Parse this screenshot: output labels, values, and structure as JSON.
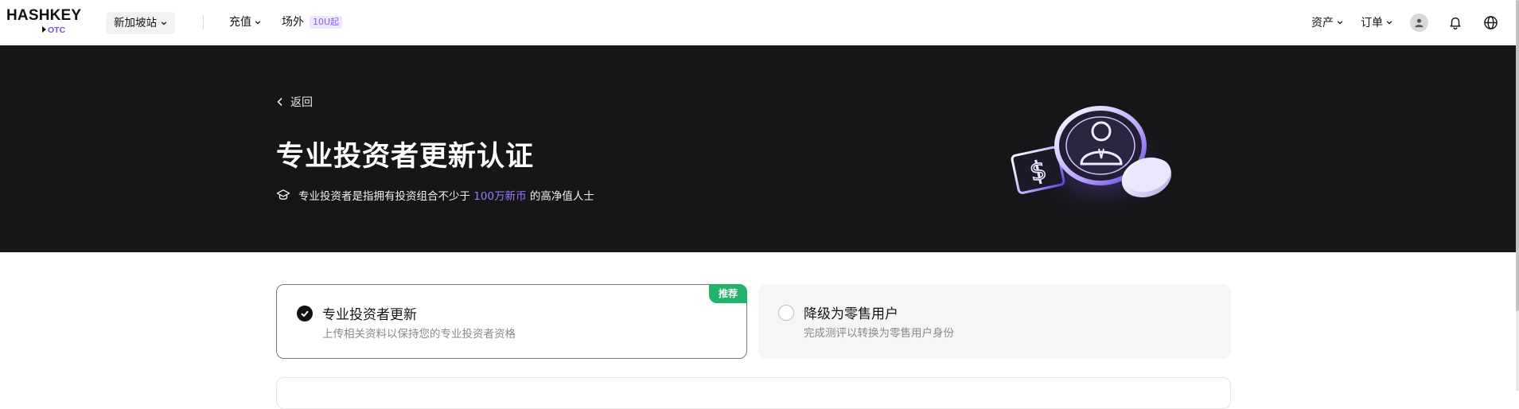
{
  "header": {
    "logo_text": "HASHKEY",
    "logo_sub": "OTC",
    "site_label": "新加坡站",
    "nav": {
      "deposit": "充值",
      "otc": "场外",
      "otc_badge": "10U起"
    },
    "assets": "资产",
    "orders": "订单",
    "icons": [
      "user-avatar-icon",
      "bell-icon",
      "globe-icon"
    ]
  },
  "hero": {
    "back_label": "返回",
    "title": "专业投资者更新认证",
    "desc_prefix": "专业投资者是指拥有投资组合不少于",
    "desc_highlight": "100万新币",
    "desc_suffix": "的高净值人士",
    "colors": {
      "background": "#161618",
      "highlight": "#9b7bff"
    }
  },
  "options": [
    {
      "title": "专业投资者更新",
      "subtitle": "上传相关资料以保持您的专业投资者资格",
      "badge": "推荐",
      "selected": true
    },
    {
      "title": "降级为零售用户",
      "subtitle": "完成测评以转换为零售用户身份",
      "selected": false
    }
  ],
  "colors": {
    "accent": "#8a5cf6",
    "badge_green": "#22b26b"
  }
}
